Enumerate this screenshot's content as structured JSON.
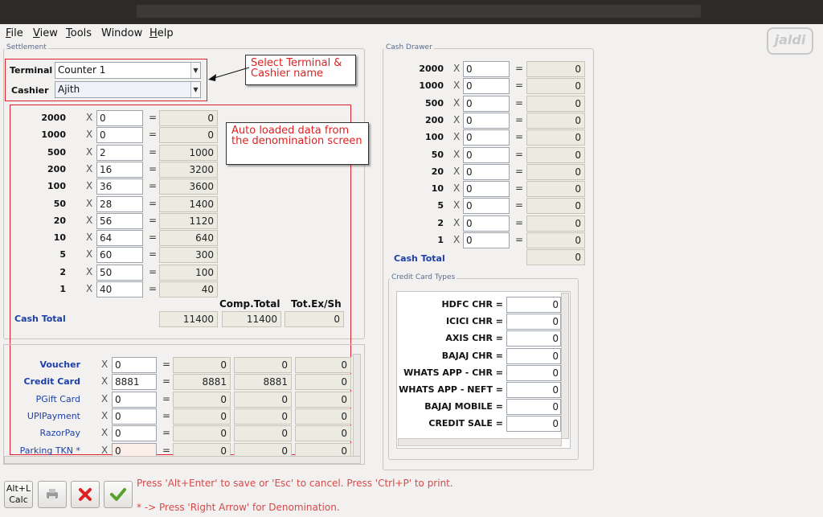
{
  "menu": {
    "items": [
      {
        "label": "File",
        "u": "F",
        "rest": "ile"
      },
      {
        "label": "View",
        "u": "V",
        "rest": "iew"
      },
      {
        "label": "Tools",
        "u": "T",
        "rest": "ools"
      },
      {
        "label": "Window",
        "u": "",
        "rest": "Window"
      },
      {
        "label": "Help",
        "u": "H",
        "rest": "elp"
      }
    ]
  },
  "logo": "jaldi",
  "settlement": {
    "legend": "Settlement",
    "terminal_label": "Terminal",
    "terminal_value": "Counter 1",
    "cashier_label": "Cashier",
    "cashier_value": "Ajith",
    "denominations": [
      {
        "denom": "2000",
        "qty": "0",
        "total": "0"
      },
      {
        "denom": "1000",
        "qty": "0",
        "total": "0"
      },
      {
        "denom": "500",
        "qty": "2",
        "total": "1000"
      },
      {
        "denom": "200",
        "qty": "16",
        "total": "3200"
      },
      {
        "denom": "100",
        "qty": "36",
        "total": "3600"
      },
      {
        "denom": "50",
        "qty": "28",
        "total": "1400"
      },
      {
        "denom": "20",
        "qty": "56",
        "total": "1120"
      },
      {
        "denom": "10",
        "qty": "64",
        "total": "640"
      },
      {
        "denom": "5",
        "qty": "60",
        "total": "300"
      },
      {
        "denom": "2",
        "qty": "50",
        "total": "100"
      },
      {
        "denom": "1",
        "qty": "40",
        "total": "40"
      }
    ],
    "comp_total_label": "Comp.Total",
    "tot_exsh_label": "Tot.Ex/Sh",
    "cash_total_label": "Cash Total",
    "cash_total": "11400",
    "comp_total": "11400",
    "tot_exsh": "0",
    "payments": [
      {
        "label": "Voucher",
        "qty": "0",
        "a": "0",
        "b": "0",
        "c": "0",
        "style": "bold"
      },
      {
        "label": "Credit Card",
        "qty": "8881",
        "a": "8881",
        "b": "8881",
        "c": "0",
        "style": "bold"
      },
      {
        "label": "PGift Card",
        "qty": "0",
        "a": "0",
        "b": "0",
        "c": "0",
        "style": "plain"
      },
      {
        "label": "UPIPayment",
        "qty": "0",
        "a": "0",
        "b": "0",
        "c": "0",
        "style": "plain"
      },
      {
        "label": "RazorPay",
        "qty": "0",
        "a": "0",
        "b": "0",
        "c": "0",
        "style": "plain"
      },
      {
        "label": "Parking TKN *",
        "qty": "0",
        "a": "0",
        "b": "0",
        "c": "0",
        "style": "plain"
      }
    ]
  },
  "callouts": {
    "terminal": "Select Terminal & Cashier name",
    "auto": "Auto loaded data from the denomination screen"
  },
  "cash_drawer": {
    "legend": "Cash Drawer",
    "rows": [
      {
        "denom": "2000",
        "qty": "0",
        "total": "0"
      },
      {
        "denom": "1000",
        "qty": "0",
        "total": "0"
      },
      {
        "denom": "500",
        "qty": "0",
        "total": "0"
      },
      {
        "denom": "200",
        "qty": "0",
        "total": "0"
      },
      {
        "denom": "100",
        "qty": "0",
        "total": "0"
      },
      {
        "denom": "50",
        "qty": "0",
        "total": "0"
      },
      {
        "denom": "20",
        "qty": "0",
        "total": "0"
      },
      {
        "denom": "10",
        "qty": "0",
        "total": "0"
      },
      {
        "denom": "5",
        "qty": "0",
        "total": "0"
      },
      {
        "denom": "2",
        "qty": "0",
        "total": "0"
      },
      {
        "denom": "1",
        "qty": "0",
        "total": "0"
      }
    ],
    "cash_total_label": "Cash Total",
    "cash_total": "0"
  },
  "credit_card_types": {
    "legend": "Credit Card Types",
    "rows": [
      {
        "label": "HDFC CHR =",
        "value": "0"
      },
      {
        "label": "ICICI CHR =",
        "value": "0"
      },
      {
        "label": "AXIS CHR =",
        "value": "0"
      },
      {
        "label": "BAJAJ CHR =",
        "value": "0"
      },
      {
        "label": "WHATS APP - CHR =",
        "value": "0"
      },
      {
        "label": "WHATS APP - NEFT =",
        "value": "0"
      },
      {
        "label": "BAJAJ MOBILE =",
        "value": "0"
      },
      {
        "label": "CREDIT SALE =",
        "value": "0"
      }
    ]
  },
  "toolbar": {
    "calc_line1": "Alt+L",
    "calc_line2": "Calc"
  },
  "hints": {
    "line1": "Press 'Alt+Enter' to save or 'Esc' to cancel. Press 'Ctrl+P' to print.",
    "line2": "* -> Press 'Right Arrow' for Denomination."
  },
  "colors": {
    "accent_blue": "#1e3fa8",
    "callout_red": "#e02020",
    "hint_red": "#d64a4a"
  }
}
